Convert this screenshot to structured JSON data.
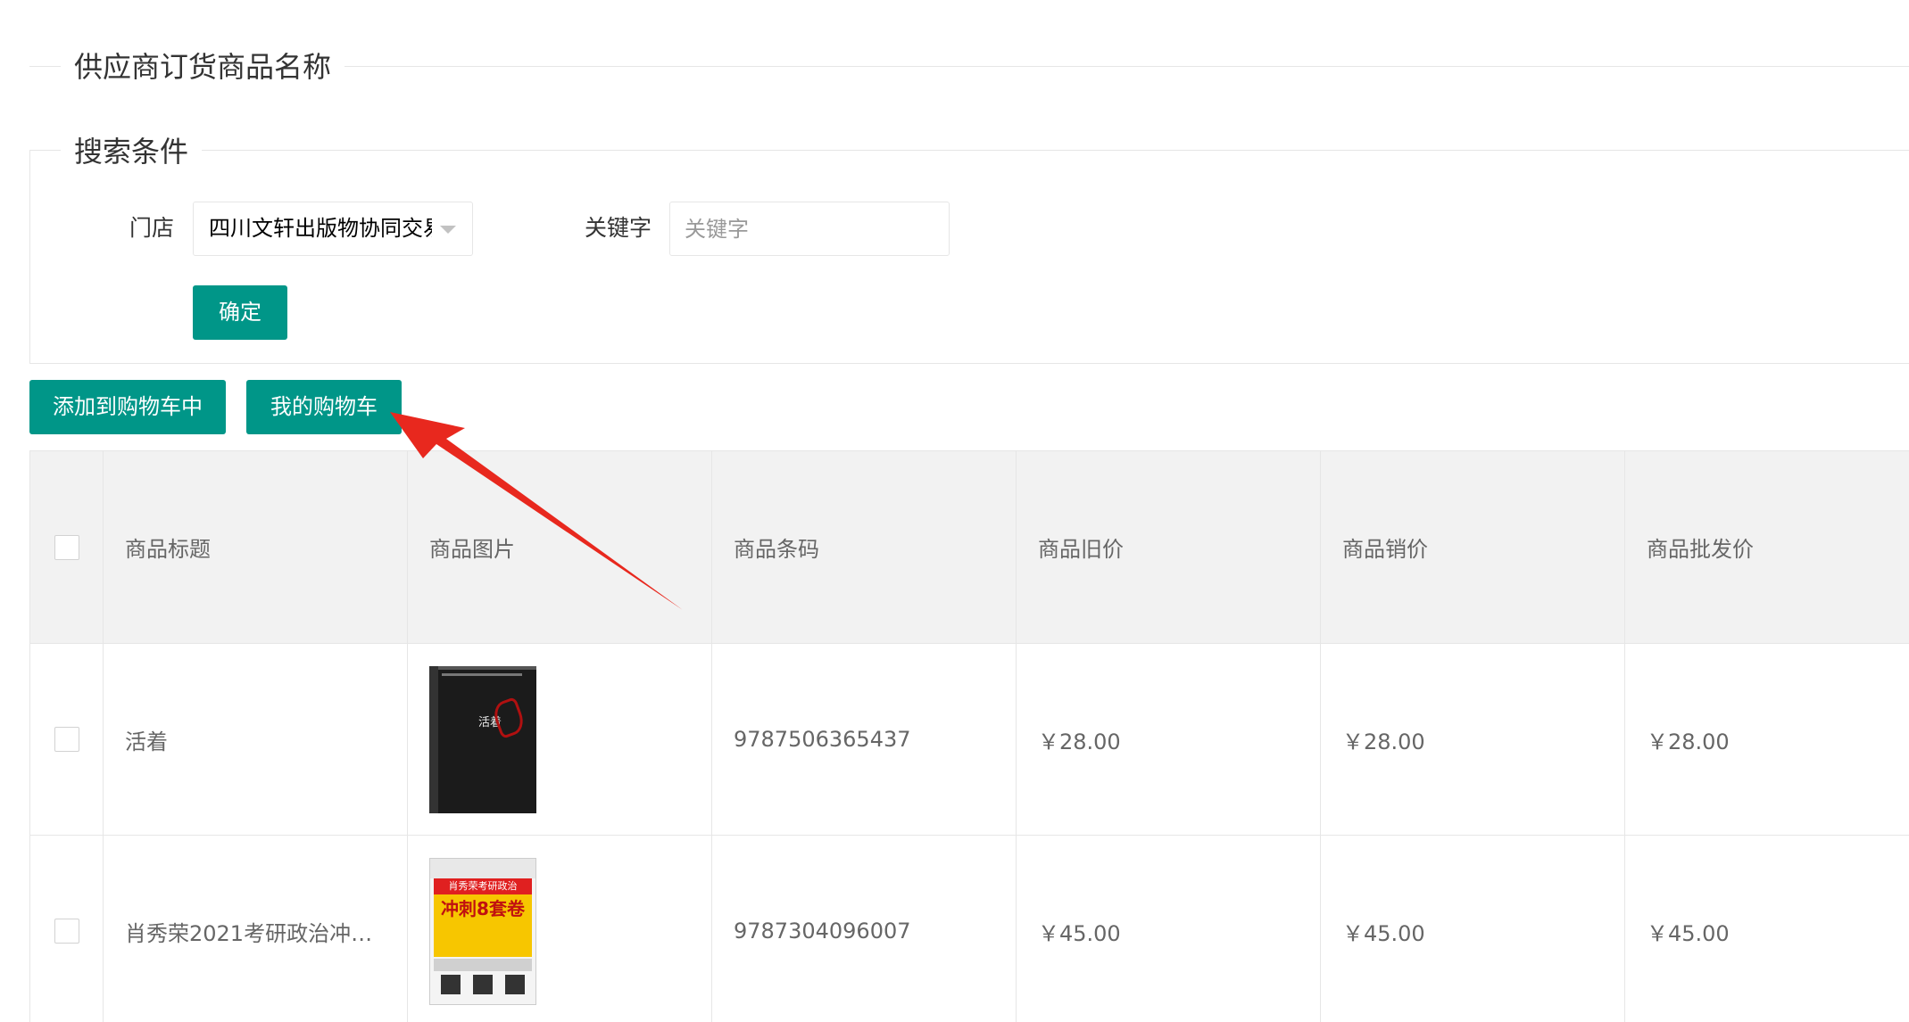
{
  "page": {
    "title": "供应商订货商品名称"
  },
  "search": {
    "section_title": "搜索条件",
    "store_label": "门店",
    "store_selected": "四川文轩出版物协同交易",
    "keyword_label": "关键字",
    "keyword_value": "",
    "keyword_placeholder": "关键字",
    "confirm_label": "确定"
  },
  "toolbar": {
    "add_to_cart_label": "添加到购物车中",
    "my_cart_label": "我的购物车"
  },
  "table": {
    "headers": [
      "商品标题",
      "商品图片",
      "商品条码",
      "商品旧价",
      "商品销价",
      "商品批发价"
    ],
    "rows": [
      {
        "title": "活着",
        "barcode": "9787506365437",
        "old_price": "￥28.00",
        "sale_price": "￥28.00",
        "wholesale_price": "￥28.00",
        "cover_text": "活着"
      },
      {
        "title": "肖秀荣2021考研政治冲刺...",
        "barcode": "9787304096007",
        "old_price": "￥45.00",
        "sale_price": "￥45.00",
        "wholesale_price": "￥45.00",
        "cover_text": "肖秀荣考研政治",
        "cover_text_2": "冲刺8套卷"
      }
    ]
  },
  "colors": {
    "primary": "#009688",
    "annotation_arrow": "#e8281e",
    "border": "#e6e6e6",
    "header_bg": "#f2f2f2"
  }
}
